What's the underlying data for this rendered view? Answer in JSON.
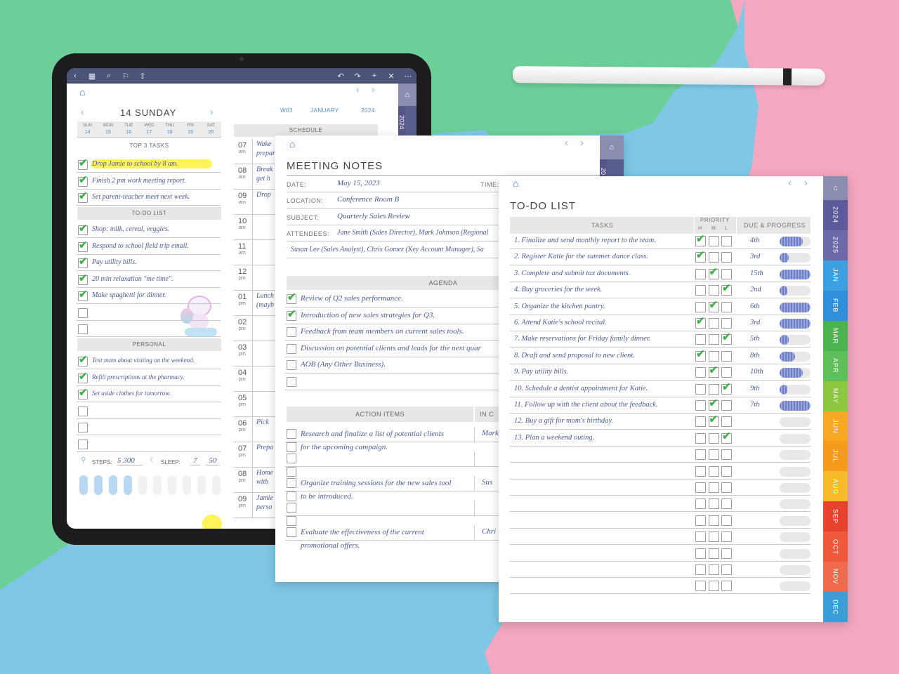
{
  "colors": {
    "green": "#6cce98",
    "blue": "#7ec8e6",
    "pink": "#f3a7c0",
    "accent": "#4b5478",
    "check": "#3fb24a",
    "highlight": "#fff35a"
  },
  "ipad": {
    "toolbar_icons": [
      "back-icon",
      "grid-icon",
      "search-icon",
      "bookmark-icon",
      "share-icon",
      "undo-icon",
      "redo-icon",
      "add-icon",
      "close-icon",
      "more-icon"
    ],
    "week": "W03",
    "month": "JANUARY",
    "year": "2024",
    "side_year": "2024",
    "day_title": "14 SUNDAY",
    "days": [
      {
        "d": "SUN",
        "n": "14"
      },
      {
        "d": "MON",
        "n": "15"
      },
      {
        "d": "TUE",
        "n": "16"
      },
      {
        "d": "WED",
        "n": "17"
      },
      {
        "d": "THU",
        "n": "18"
      },
      {
        "d": "FRI",
        "n": "19"
      },
      {
        "d": "SAT",
        "n": "20"
      }
    ],
    "top3_label": "TOP 3 TASKS",
    "top3": [
      "Drop Jamie to school by 8 am.",
      "Finish 2 pm work meeting report.",
      "Set parent-teacher meet next week."
    ],
    "todo_label": "TO-DO LIST",
    "todo": [
      "Shop: milk, cereal, veggies.",
      "Respond to school field trip email.",
      "Pay utility bills.",
      "20 min relaxation \"me time\".",
      "Make spaghetti for dinner."
    ],
    "personal_label": "PERSONAL",
    "personal": [
      "Text mom about visiting on the weekend.",
      "Refill prescriptions at the pharmacy.",
      "Set aside clothes for tomorrow."
    ],
    "steps_label": "STEPS:",
    "steps_value": "5 300",
    "sleep_label": "SLEEP:",
    "sleep_h": "7",
    "sleep_m": "50",
    "schedule_label": "SCHEDULE",
    "hours": [
      {
        "h": "07",
        "p": "am",
        "t": "Wake"
      },
      {
        "h": "08",
        "p": "am",
        "t": "Break"
      },
      {
        "h": "09",
        "p": "am",
        "t": "Drop"
      },
      {
        "h": "10",
        "p": "am",
        "t": ""
      },
      {
        "h": "11",
        "p": "am",
        "t": ""
      },
      {
        "h": "12",
        "p": "pm",
        "t": ""
      },
      {
        "h": "01",
        "p": "pm",
        "t": "Lunch"
      },
      {
        "h": "02",
        "p": "pm",
        "t": ""
      },
      {
        "h": "03",
        "p": "pm",
        "t": ""
      },
      {
        "h": "04",
        "p": "pm",
        "t": ""
      },
      {
        "h": "05",
        "p": "pm",
        "t": ""
      },
      {
        "h": "06",
        "p": "pm",
        "t": "Pick"
      },
      {
        "h": "07",
        "p": "pm",
        "t": "Prepa"
      },
      {
        "h": "08",
        "p": "pm",
        "t": "Home"
      },
      {
        "h": "09",
        "p": "pm",
        "t": "Jamie"
      }
    ],
    "hour_sub": {
      "0": "prepar",
      "1": "get h",
      "6": "(mayb",
      "13": "with",
      "14": "perso"
    }
  },
  "meeting": {
    "title": "MEETING NOTES",
    "date_label": "DATE:",
    "date_value": "May 15, 2023",
    "time_label": "TIME:",
    "location_label": "LOCATION:",
    "location_value": "Conference Room B",
    "subject_label": "SUBJECT:",
    "subject_value": "Quarterly Sales Review",
    "attendees_label": "ATTENDEES:",
    "attendees_line1": "Jane Smith (Sales Director), Mark Johnson (Regional",
    "attendees_line2": "Susan Lee (Sales Analyst), Chris Gomez (Key Account Manager), Sa",
    "agenda_label": "AGENDA",
    "agenda": [
      {
        "t": "Review of Q2 sales performance.",
        "c": true
      },
      {
        "t": "Introduction of new sales strategies for Q3.",
        "c": true
      },
      {
        "t": "Feedback from team members on current sales tools.",
        "c": false
      },
      {
        "t": "Discussion on potential clients and leads for the next quar",
        "c": false
      },
      {
        "t": "AOB (Any Other Business).",
        "c": false
      },
      {
        "t": "",
        "c": false
      }
    ],
    "action_label": "ACTION ITEMS",
    "in_label": "IN C",
    "actions": [
      {
        "t1": "Research and finalize a list of potential clients",
        "t2": "for the upcoming campaign.",
        "who": "Mark"
      },
      {
        "t1": "",
        "t2": "",
        "who": ""
      },
      {
        "t1": "Organize training sessions for the new sales tool",
        "t2": "to be introduced.",
        "who": "Sus"
      },
      {
        "t1": "",
        "t2": "",
        "who": ""
      },
      {
        "t1": "Evaluate the effectiveness of the current",
        "t2": "promotional offers.",
        "who": "Chri"
      }
    ],
    "side_year": "20"
  },
  "todo": {
    "title": "TO-DO LIST",
    "tasks_label": "TASKS",
    "priority_label": "PRIORITY",
    "h": "H",
    "m": "M",
    "l": "L",
    "due_label": "DUE & PROGRESS",
    "items": [
      {
        "t": "1. Finalize and send monthly report to the team.",
        "p": "H",
        "due": "4th",
        "prog": 0.75
      },
      {
        "t": "2. Register Katie for the summer dance class.",
        "p": "H",
        "due": "3rd",
        "prog": 0.3
      },
      {
        "t": "3. Complete and submit tax documents.",
        "p": "M",
        "due": "15th",
        "prog": 1.0
      },
      {
        "t": "4. Buy groceries for the week.",
        "p": "L",
        "due": "2nd",
        "prog": 0.25
      },
      {
        "t": "5. Organize the kitchen pantry.",
        "p": "M",
        "due": "6th",
        "prog": 1.0
      },
      {
        "t": "6. Attend Katie's school recital.",
        "p": "H",
        "due": "3rd",
        "prog": 1.0
      },
      {
        "t": "7. Make reservations for Friday family dinner.",
        "p": "L",
        "due": "5th",
        "prog": 0.3
      },
      {
        "t": "8. Draft and send proposal to new client.",
        "p": "H",
        "due": "8th",
        "prog": 0.5
      },
      {
        "t": "9. Pay utility bills.",
        "p": "M",
        "due": "10th",
        "prog": 0.75
      },
      {
        "t": "10. Schedule a dentist appointment for Katie.",
        "p": "L",
        "due": "9th",
        "prog": 0.25
      },
      {
        "t": "11. Follow up with the client about the feedback.",
        "p": "M",
        "due": "7th",
        "prog": 1.0
      },
      {
        "t": "12. Buy a gift for mom's birthday.",
        "p": "M",
        "due": "",
        "prog": 0
      },
      {
        "t": "13. Plan a weekend outing.",
        "p": "L",
        "due": "",
        "prog": 0
      }
    ],
    "empty_rows": 9,
    "side_tabs": [
      {
        "l": "2024",
        "c": "#5b5a9a"
      },
      {
        "l": "2025",
        "c": "#6c6aa8"
      },
      {
        "l": "JAN",
        "c": "#3b9fe0"
      },
      {
        "l": "FEB",
        "c": "#2f8fd8"
      },
      {
        "l": "MAR",
        "c": "#4bb34f"
      },
      {
        "l": "APR",
        "c": "#5dc05a"
      },
      {
        "l": "MAY",
        "c": "#8dc63f"
      },
      {
        "l": "JUN",
        "c": "#f7a823"
      },
      {
        "l": "JUL",
        "c": "#f59b1c"
      },
      {
        "l": "AUG",
        "c": "#f8b92a"
      },
      {
        "l": "SEP",
        "c": "#e8432f"
      },
      {
        "l": "OCT",
        "c": "#ee5a3a"
      },
      {
        "l": "NOV",
        "c": "#f06a4e"
      },
      {
        "l": "DEC",
        "c": "#3a9ed9"
      }
    ]
  }
}
